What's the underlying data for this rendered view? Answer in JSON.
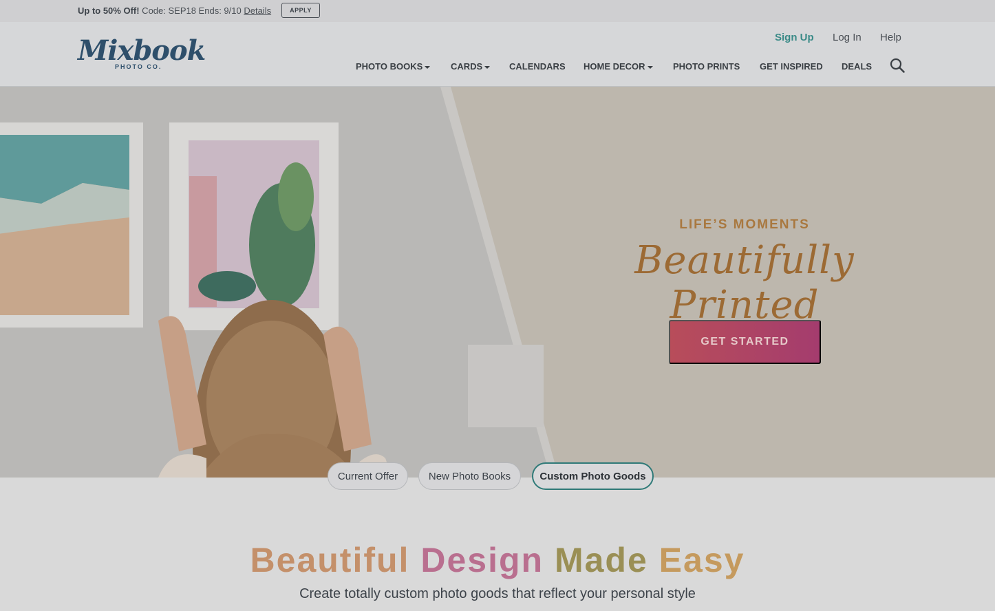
{
  "promo": {
    "headline": "Up to 50% Off!",
    "details_text": " Code: SEP18 Ends: 9/10 ",
    "details_link": "Details",
    "apply_label": "APPLY"
  },
  "header": {
    "logo_word": "Mixbook",
    "logo_sub": "PHOTO CO.",
    "sign_up": "Sign Up",
    "log_in": "Log In",
    "help": "Help",
    "nav": [
      {
        "label": "PHOTO BOOKS",
        "dropdown": true
      },
      {
        "label": "CARDS",
        "dropdown": true
      },
      {
        "label": "CALENDARS",
        "dropdown": false
      },
      {
        "label": "HOME DECOR",
        "dropdown": true
      },
      {
        "label": "PHOTO PRINTS",
        "dropdown": false
      },
      {
        "label": "GET INSPIRED",
        "dropdown": false
      },
      {
        "label": "DEALS",
        "dropdown": false
      }
    ],
    "search_icon": "search-icon"
  },
  "hero": {
    "tagline": "LIFE’S MOMENTS",
    "script_title": "Beautifully Printed",
    "cta_label": "GET STARTED"
  },
  "carousel_tabs": [
    {
      "label": "Current Offer",
      "active": false
    },
    {
      "label": "New Photo Books",
      "active": false
    },
    {
      "label": "Custom Photo Goods",
      "active": true
    }
  ],
  "section": {
    "headline_words": [
      "Beautiful",
      "Design",
      "Made",
      "Easy"
    ],
    "subhead": "Create totally custom photo goods that reflect your personal style"
  },
  "colors": {
    "accent_teal": "#3a8a87",
    "brand_navy": "#2e4f6b",
    "cta_start": "#b84d5a",
    "cta_end": "#a43c6e",
    "gold": "#a9783f"
  }
}
